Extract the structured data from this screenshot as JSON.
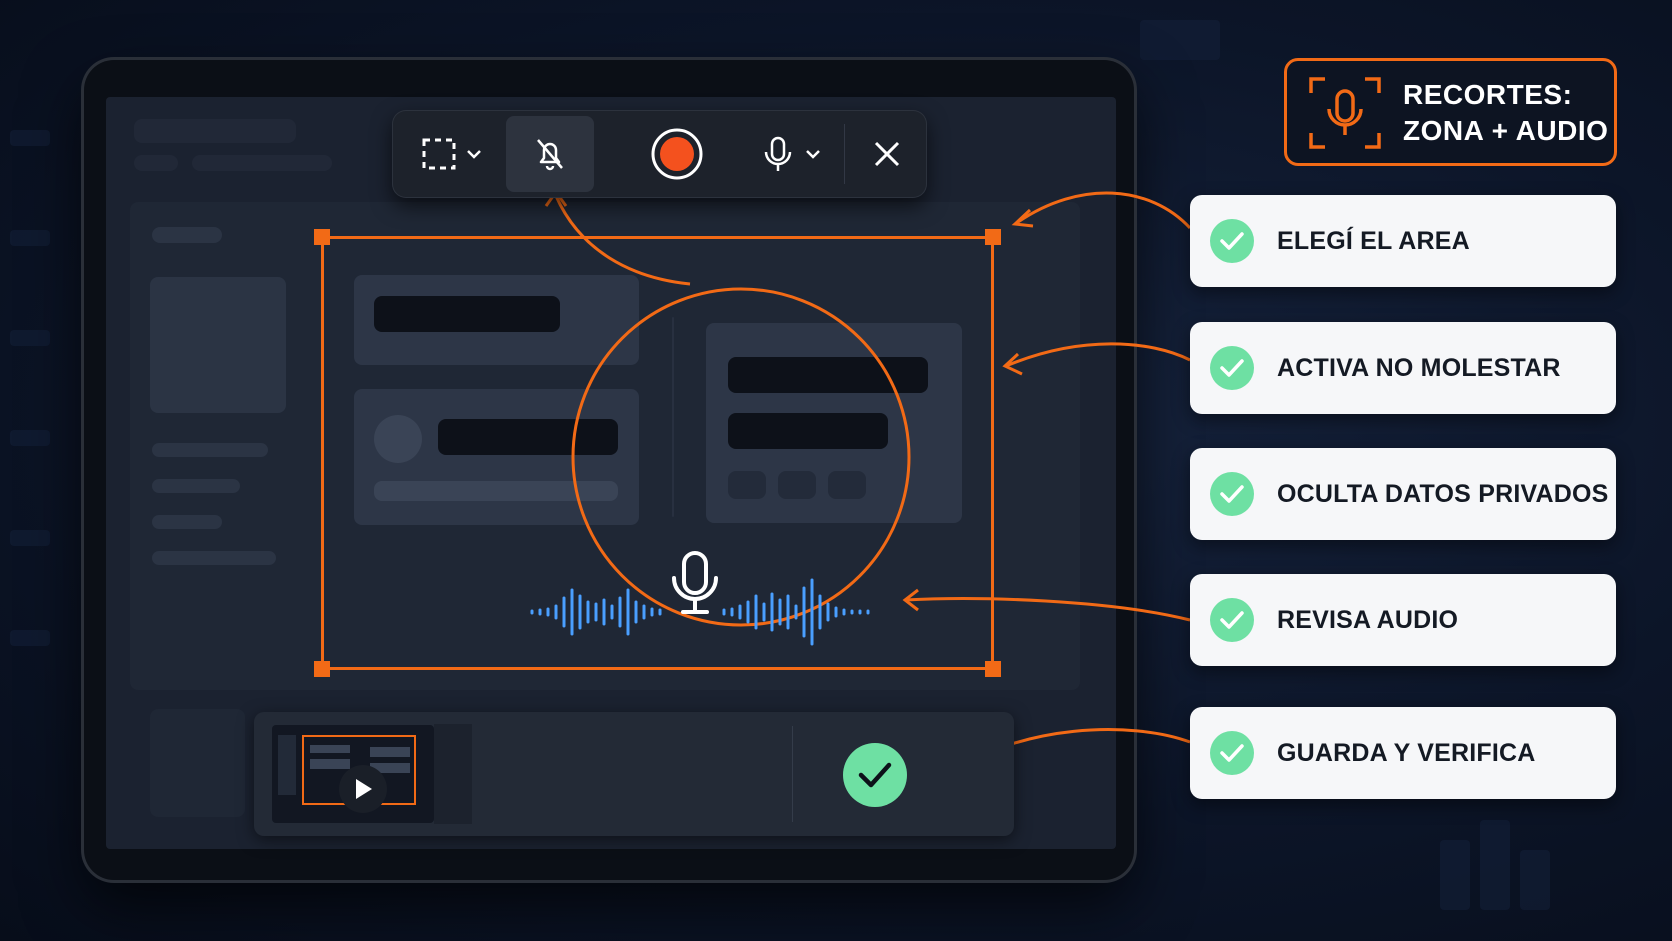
{
  "badge": {
    "line1": "RECORTES:",
    "line2": "ZONA + AUDIO",
    "icon": "mic-in-dashed-frame-icon"
  },
  "steps": [
    {
      "label": "ELEGÍ EL AREA",
      "icon": "check-icon"
    },
    {
      "label": "ACTIVA NO MOLESTAR",
      "icon": "check-icon"
    },
    {
      "label": "OCULTA DATOS PRIVADOS",
      "icon": "check-icon"
    },
    {
      "label": "REVISA AUDIO",
      "icon": "check-icon"
    },
    {
      "label": "GUARDA Y VERIFICA",
      "icon": "check-icon"
    }
  ],
  "toolbar": {
    "buttons": [
      "region-select-icon",
      "bell-off-icon",
      "record-icon",
      "mic-icon",
      "close-icon"
    ]
  },
  "colors": {
    "accent": "#f26a16",
    "check": "#6ee0a3",
    "record": "#f4511e",
    "waveform": "#4a9fff"
  }
}
